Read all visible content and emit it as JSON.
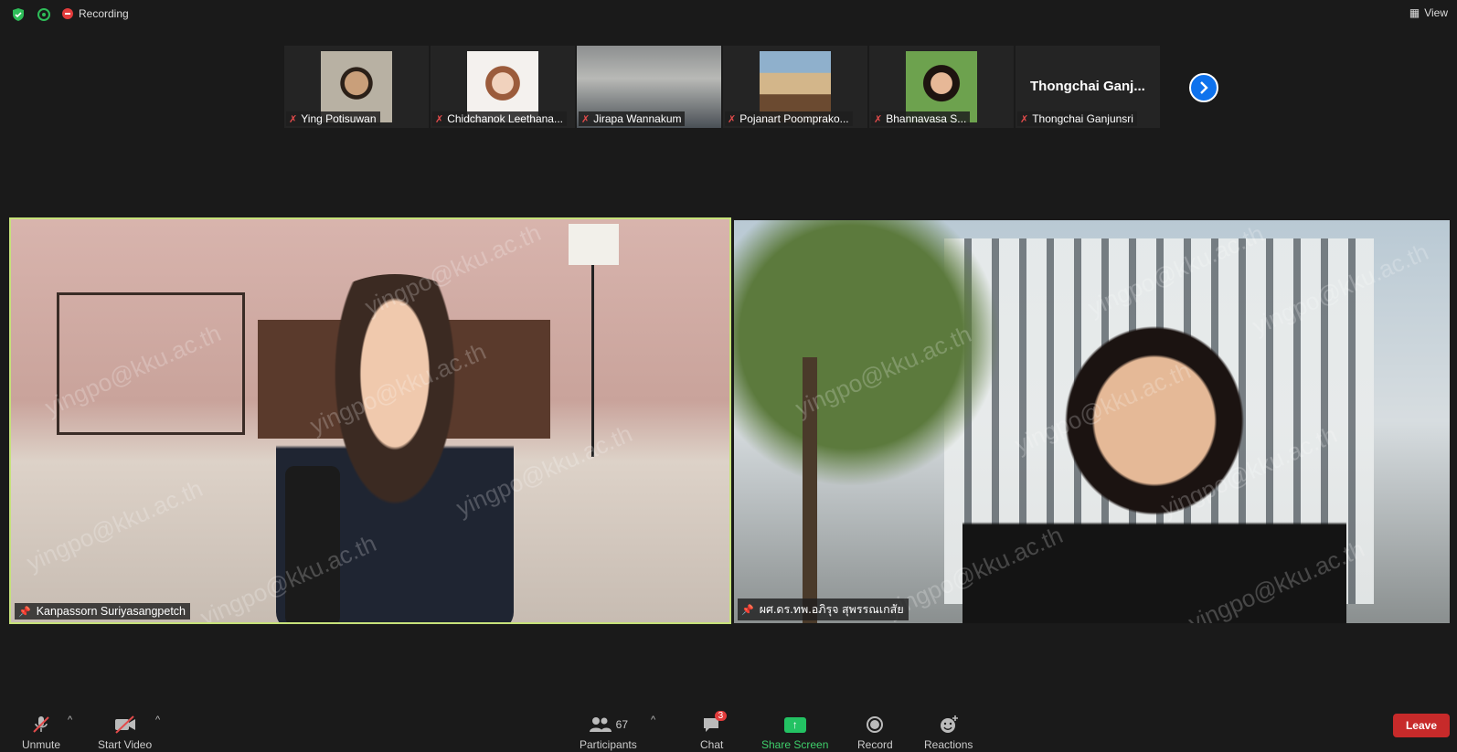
{
  "status": {
    "recording_label": "Recording",
    "view_label": "View"
  },
  "gallery": [
    {
      "name": "Ying Potisuwan"
    },
    {
      "name": "Chidchanok Leethana..."
    },
    {
      "name": "Jirapa Wannakum"
    },
    {
      "name": "Pojanart Poomprako..."
    },
    {
      "name": "Bhannavasa S..."
    },
    {
      "name": "Thongchai Ganjunsri",
      "display_name": "Thongchai Ganj..."
    }
  ],
  "videos": [
    {
      "name": "Kanpassorn Suriyasangpetch"
    },
    {
      "name": "ผศ.ดร.ทพ.อภิรุจ สุพรรณเกสัย"
    }
  ],
  "watermark_text": "yingpo@kku.ac.th",
  "toolbar": {
    "unmute": "Unmute",
    "start_video": "Start Video",
    "participants_count": "67",
    "participants": "Participants",
    "chat_badge": "3",
    "chat": "Chat",
    "share_screen": "Share Screen",
    "record": "Record",
    "reactions": "Reactions",
    "leave": "Leave"
  },
  "colors": {
    "active_speaker_border": "#c7e27a",
    "share_green": "#23c263",
    "leave_red": "#c72a2a",
    "accent_blue": "#0e72ed"
  }
}
